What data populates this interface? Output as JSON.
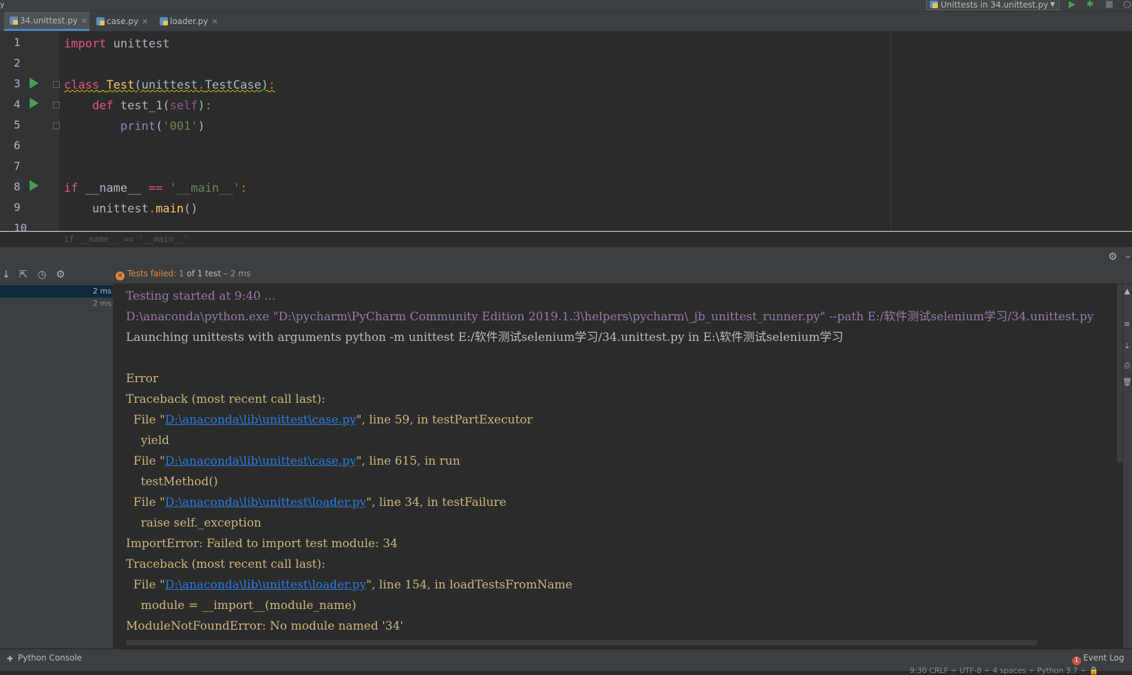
{
  "window": {
    "menu_fragment": "y",
    "run_config_label": "Unittests in 34.unittest.py",
    "run_button_icon": "run-icon",
    "debug_button_icon": "debug-icon",
    "stop_button_icon": "stop-icon"
  },
  "tabs": [
    {
      "label": "34.unittest.py",
      "active": true
    },
    {
      "label": "case.py",
      "active": false
    },
    {
      "label": "loader.py",
      "active": false
    }
  ],
  "editor": {
    "line_numbers": [
      "1",
      "2",
      "3",
      "4",
      "5",
      "6",
      "7",
      "8",
      "9",
      "10"
    ],
    "breadcrumb": "if __name__ == '__main__'"
  },
  "run_panel": {
    "status": {
      "prefix": "Tests failed: ",
      "failed_count": "1",
      "rest": " of 1 test",
      "duration": " – 2 ms"
    },
    "tree": [
      {
        "time": "2 ms",
        "selected": true
      },
      {
        "time": "2 ms",
        "selected": false
      }
    ],
    "console": {
      "line1": "Testing started at 9:40 ...",
      "line2": "D:\\anaconda\\python.exe \"D:\\pycharm\\PyCharm Community Edition 2019.1.3\\helpers\\pycharm\\_jb_unittest_runner.py\" --path E:/软件测试selenium学习/34.unittest.py",
      "line3": "Launching unittests with arguments python -m unittest E:/软件测试selenium学习/34.unittest.py in E:\\软件测试selenium学习",
      "line5": "Error",
      "line6": "Traceback (most recent call last):",
      "file_prefix": "  File \"",
      "case_path": "D:\\anaconda\\lib\\unittest\\case.py",
      "loader_path": "D:\\anaconda\\lib\\unittest\\loader.py",
      "line7_suffix": "\", line 59, in testPartExecutor",
      "line8": "    yield",
      "line9_suffix": "\", line 615, in run",
      "line10": "    testMethod()",
      "line11_suffix": "\", line 34, in testFailure",
      "line12": "    raise self._exception",
      "line13": "ImportError: Failed to import test module: 34",
      "line14": "Traceback (most recent call last):",
      "line15_suffix": "\", line 154, in loadTestsFromName",
      "line16": "    module = __import__(module_name)",
      "line17": "ModuleNotFoundError: No module named '34'"
    }
  },
  "bottom_bar": {
    "python_console": "Python Console",
    "event_log": "Event Log",
    "event_badge": "1",
    "status_line": "9:30   CRLF ÷   UTF-8 ÷   4 spaces ÷   Python 3.7 ÷   🔒"
  },
  "colors": {
    "accent": "#4a88c7",
    "run_green": "#499c54",
    "fail_orange": "#e0883d",
    "link_blue": "#287bde"
  }
}
